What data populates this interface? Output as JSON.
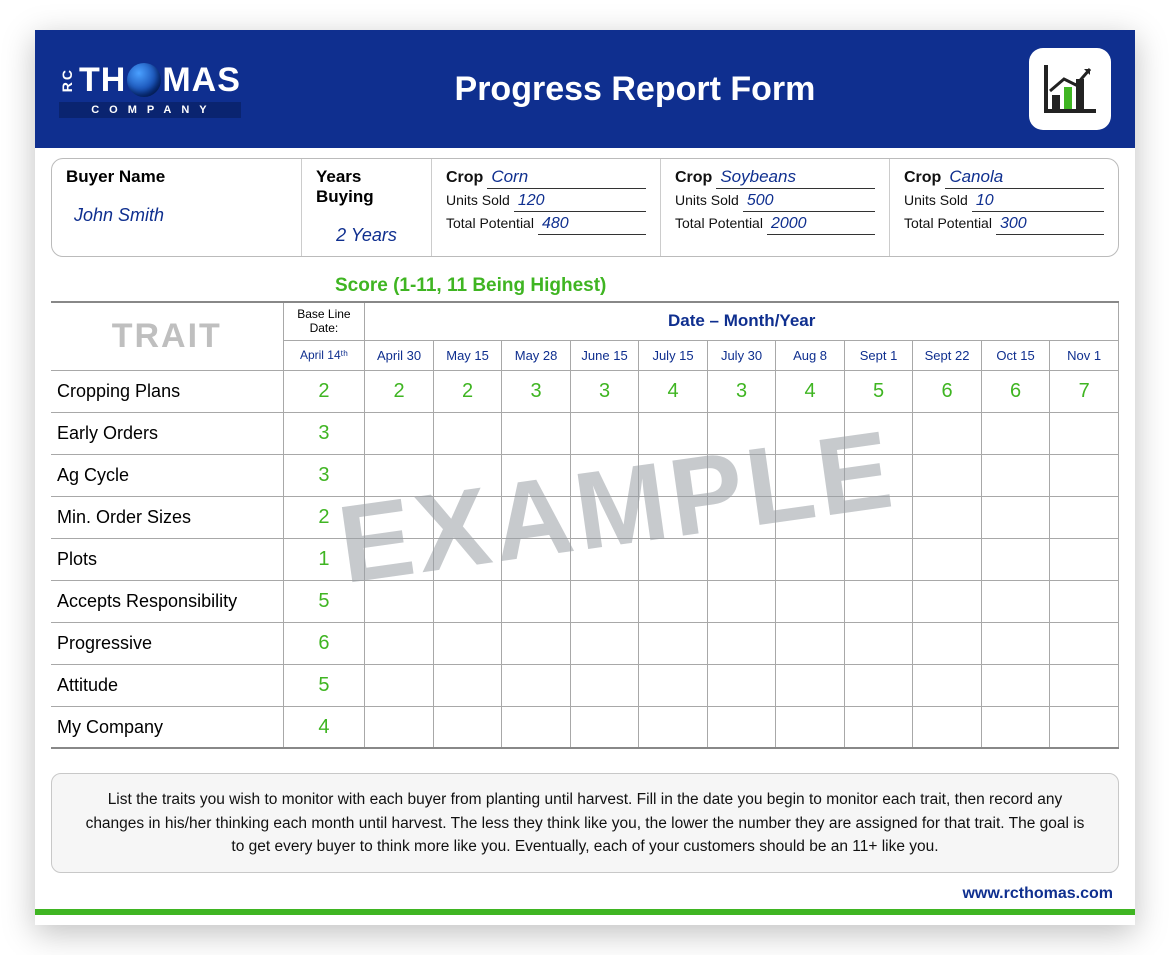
{
  "header": {
    "logo_rc": "RC",
    "logo_main_1": "TH",
    "logo_main_2": "MAS",
    "logo_sub": "COMPANY",
    "title": "Progress Report Form"
  },
  "info": {
    "buyer_label": "Buyer Name",
    "buyer_value": "John Smith",
    "years_label": "Years Buying",
    "years_value": "2 Years",
    "crops": [
      {
        "crop_label": "Crop",
        "crop": "Corn",
        "units_label": "Units Sold",
        "units": "120",
        "pot_label": "Total Potential",
        "pot": "480"
      },
      {
        "crop_label": "Crop",
        "crop": "Soybeans",
        "units_label": "Units Sold",
        "units": "500",
        "pot_label": "Total Potential",
        "pot": "2000"
      },
      {
        "crop_label": "Crop",
        "crop": "Canola",
        "units_label": "Units Sold",
        "units": "10",
        "pot_label": "Total Potential",
        "pot": "300"
      }
    ]
  },
  "score_label": "Score (1-11, 11 Being Highest)",
  "table": {
    "trait_header": "TRAIT",
    "baseline_header": "Base Line Date:",
    "baseline_date": "April 14ᵗʰ",
    "date_header": "Date – Month/Year",
    "dates": [
      "April 30",
      "May 15",
      "May 28",
      "June 15",
      "July 15",
      "July 30",
      "Aug 8",
      "Sept 1",
      "Sept 22",
      "Oct 15",
      "Nov 1"
    ],
    "rows": [
      {
        "name": "Cropping Plans",
        "base": "2",
        "vals": [
          "2",
          "2",
          "3",
          "3",
          "4",
          "3",
          "4",
          "5",
          "6",
          "6",
          "7"
        ]
      },
      {
        "name": "Early Orders",
        "base": "3",
        "vals": [
          "",
          "",
          "",
          "",
          "",
          "",
          "",
          "",
          "",
          "",
          ""
        ]
      },
      {
        "name": "Ag Cycle",
        "base": "3",
        "vals": [
          "",
          "",
          "",
          "",
          "",
          "",
          "",
          "",
          "",
          "",
          ""
        ]
      },
      {
        "name": "Min. Order Sizes",
        "base": "2",
        "vals": [
          "",
          "",
          "",
          "",
          "",
          "",
          "",
          "",
          "",
          "",
          ""
        ]
      },
      {
        "name": "Plots",
        "base": "1",
        "vals": [
          "",
          "",
          "",
          "",
          "",
          "",
          "",
          "",
          "",
          "",
          ""
        ]
      },
      {
        "name": "Accepts Responsibility",
        "base": "5",
        "vals": [
          "",
          "",
          "",
          "",
          "",
          "",
          "",
          "",
          "",
          "",
          ""
        ]
      },
      {
        "name": "Progressive",
        "base": "6",
        "vals": [
          "",
          "",
          "",
          "",
          "",
          "",
          "",
          "",
          "",
          "",
          ""
        ]
      },
      {
        "name": "Attitude",
        "base": "5",
        "vals": [
          "",
          "",
          "",
          "",
          "",
          "",
          "",
          "",
          "",
          "",
          ""
        ]
      },
      {
        "name": "My Company",
        "base": "4",
        "vals": [
          "",
          "",
          "",
          "",
          "",
          "",
          "",
          "",
          "",
          "",
          ""
        ]
      }
    ]
  },
  "watermark": "EXAMPLE",
  "instructions": "List the traits you wish to monitor with each buyer from planting until harvest.  Fill in the date you begin to monitor each trait, then record any changes in his/her thinking each month until harvest.  The less they think like you, the lower the number they are assigned for that trait.  The goal is to get every buyer to think more like you.  Eventually, each of your customers should be an 11+ like you.",
  "footer": "www.rcthomas.com",
  "chart_data": {
    "type": "table",
    "title": "Progress Report Form — Trait Scores (1-11, 11 Being Highest)",
    "columns": [
      "Trait",
      "April 14",
      "April 30",
      "May 15",
      "May 28",
      "June 15",
      "July 15",
      "July 30",
      "Aug 8",
      "Sept 1",
      "Sept 22",
      "Oct 15",
      "Nov 1"
    ],
    "rows": [
      [
        "Cropping Plans",
        2,
        2,
        2,
        3,
        3,
        4,
        3,
        4,
        5,
        6,
        6,
        7
      ],
      [
        "Early Orders",
        3,
        null,
        null,
        null,
        null,
        null,
        null,
        null,
        null,
        null,
        null,
        null
      ],
      [
        "Ag Cycle",
        3,
        null,
        null,
        null,
        null,
        null,
        null,
        null,
        null,
        null,
        null,
        null
      ],
      [
        "Min. Order Sizes",
        2,
        null,
        null,
        null,
        null,
        null,
        null,
        null,
        null,
        null,
        null,
        null
      ],
      [
        "Plots",
        1,
        null,
        null,
        null,
        null,
        null,
        null,
        null,
        null,
        null,
        null,
        null
      ],
      [
        "Accepts Responsibility",
        5,
        null,
        null,
        null,
        null,
        null,
        null,
        null,
        null,
        null,
        null,
        null
      ],
      [
        "Progressive",
        6,
        null,
        null,
        null,
        null,
        null,
        null,
        null,
        null,
        null,
        null,
        null
      ],
      [
        "Attitude",
        5,
        null,
        null,
        null,
        null,
        null,
        null,
        null,
        null,
        null,
        null,
        null
      ],
      [
        "My Company",
        4,
        null,
        null,
        null,
        null,
        null,
        null,
        null,
        null,
        null,
        null,
        null
      ]
    ],
    "ylim": [
      1,
      11
    ]
  }
}
